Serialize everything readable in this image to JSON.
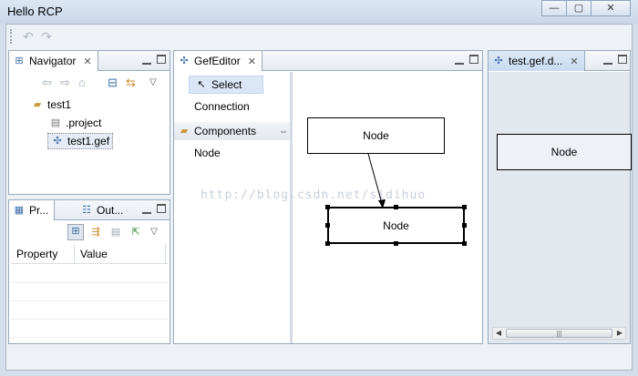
{
  "window": {
    "title": "Hello RCP",
    "minimize_glyph": "—",
    "maximize_glyph": "▢",
    "close_glyph": "✕"
  },
  "toolbar": {
    "undo_icon": "undo-icon",
    "redo_icon": "redo-icon"
  },
  "navigator": {
    "tab_label": "Navigator",
    "tree": [
      {
        "label": "test1",
        "icon": "project-folder-icon"
      },
      {
        "label": ".project",
        "icon": "file-icon"
      },
      {
        "label": "test1.gef",
        "icon": "gef-file-icon",
        "selected": true
      }
    ]
  },
  "properties": {
    "tab_label": "Pr...",
    "outline_tab_label": "Out...",
    "columns": [
      "Property",
      "Value"
    ]
  },
  "editor": {
    "tab_label": "GefEditor",
    "palette": {
      "tools": [
        {
          "label": "Select",
          "selected": true
        },
        {
          "label": "Connection"
        }
      ],
      "drawer_label": "Components",
      "entries": [
        "Node"
      ]
    },
    "nodes": [
      "Node",
      "Node"
    ],
    "watermark": "http://blog.csdn.net/sidihuo"
  },
  "outline": {
    "tab_label": "test.gef.d...",
    "node_label": "Node"
  }
}
